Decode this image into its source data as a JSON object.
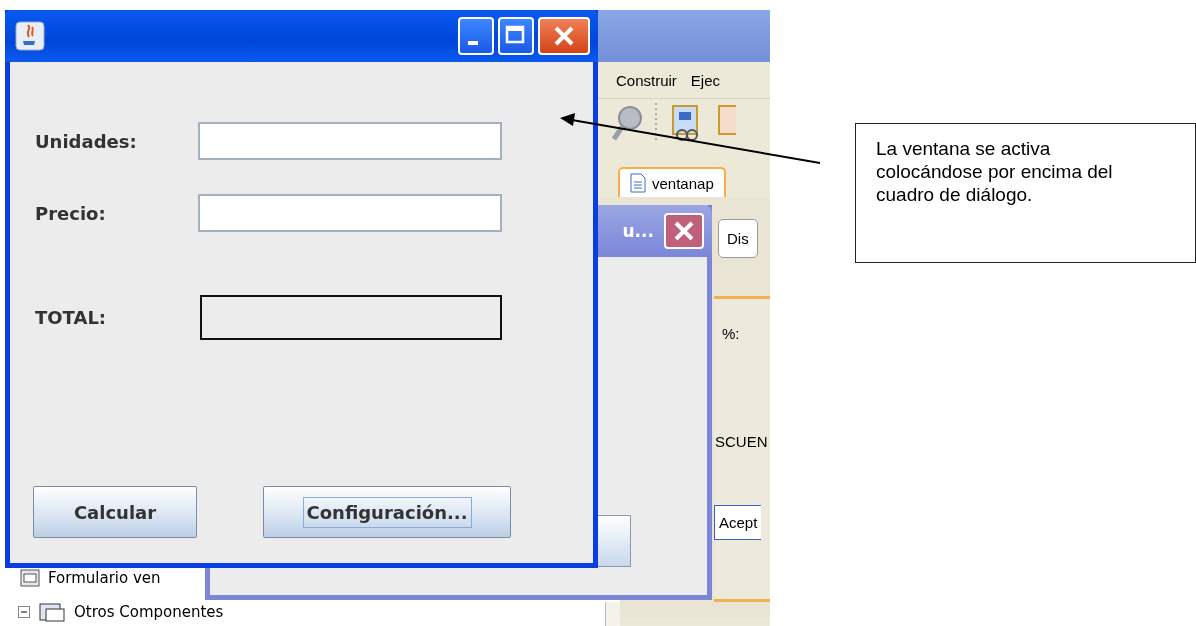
{
  "ide_window": {
    "menu": [
      "Construir",
      "Ejec"
    ],
    "file_tab": "ventanap",
    "design_button": "Dis",
    "design_labels": [
      "%:",
      "SCUEN"
    ],
    "design_button_2": "Acept",
    "tree": {
      "root": "Formulario ven",
      "children": [
        {
          "label": "Otros Componentes",
          "expanded": true
        }
      ]
    }
  },
  "dialog": {
    "title": "u..."
  },
  "window": {
    "fields": [
      {
        "label": "Unidades:",
        "kind": "input"
      },
      {
        "label": "Precio:",
        "kind": "input"
      },
      {
        "label": "TOTAL:",
        "kind": "output"
      }
    ],
    "buttons": [
      {
        "label": "Calcular",
        "focused": false
      },
      {
        "label": "Configuración...",
        "focused": true
      }
    ]
  },
  "callout": {
    "text": "La ventana se activa colocándose por encima del cuadro de diálogo."
  }
}
